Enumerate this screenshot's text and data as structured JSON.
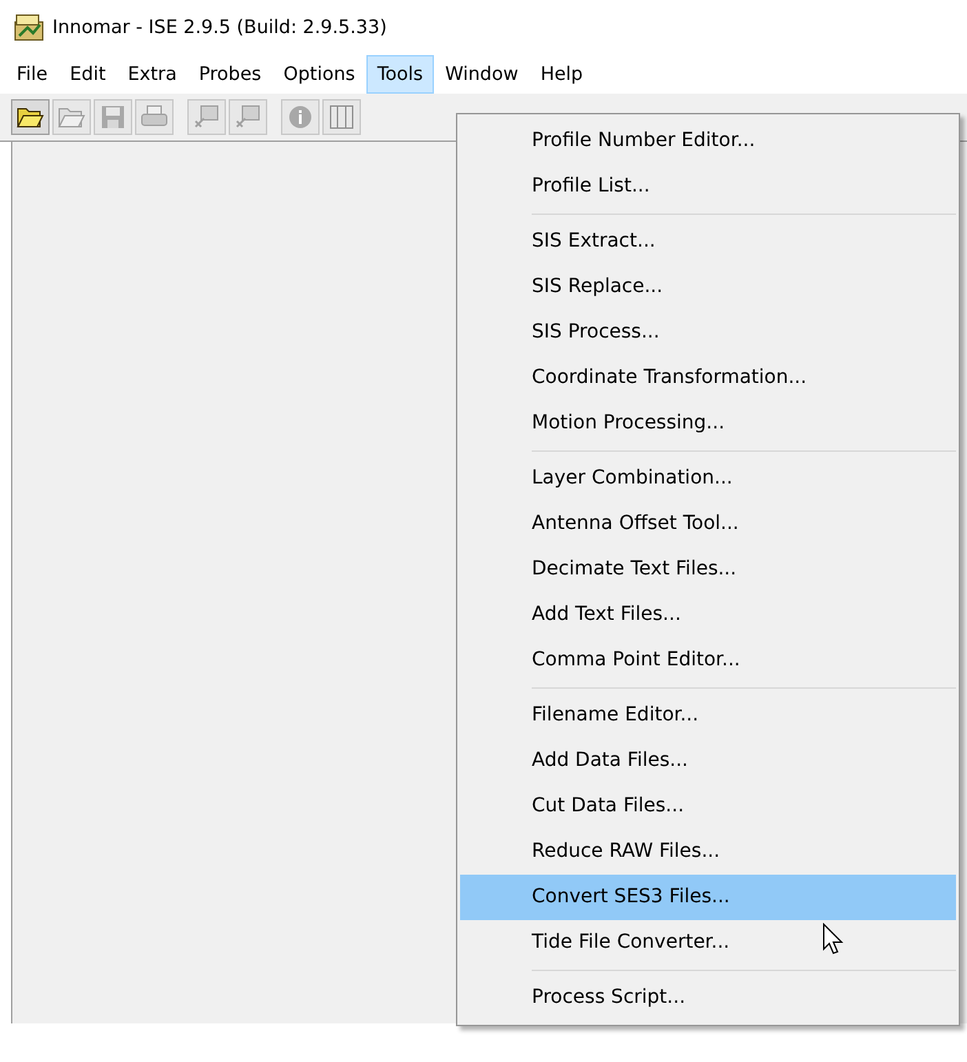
{
  "window": {
    "title": "Innomar - ISE 2.9.5 (Build: 2.9.5.33)"
  },
  "menu_bar": [
    {
      "label": "File",
      "selected": false
    },
    {
      "label": "Edit",
      "selected": false
    },
    {
      "label": "Extra",
      "selected": false
    },
    {
      "label": "Probes",
      "selected": false
    },
    {
      "label": "Options",
      "selected": false
    },
    {
      "label": "Tools",
      "selected": true
    },
    {
      "label": "Window",
      "selected": false
    },
    {
      "label": "Help",
      "selected": false
    }
  ],
  "toolbar": {
    "groups": [
      [
        {
          "disabled": false
        },
        {
          "disabled": true
        },
        {
          "disabled": true
        },
        {
          "disabled": true
        }
      ],
      [
        {
          "disabled": true
        },
        {
          "disabled": true
        }
      ],
      [
        {
          "disabled": true
        },
        {
          "disabled": true
        }
      ]
    ]
  },
  "tools_menu": {
    "groups": [
      [
        {
          "label": "Profile Number Editor...",
          "selected": false
        },
        {
          "label": "Profile List...",
          "selected": false
        }
      ],
      [
        {
          "label": "SIS Extract...",
          "selected": false
        },
        {
          "label": "SIS Replace...",
          "selected": false
        },
        {
          "label": "SIS Process...",
          "selected": false
        },
        {
          "label": "Coordinate Transformation...",
          "selected": false
        },
        {
          "label": "Motion Processing...",
          "selected": false
        }
      ],
      [
        {
          "label": "Layer Combination...",
          "selected": false
        },
        {
          "label": "Antenna Offset Tool...",
          "selected": false
        },
        {
          "label": "Decimate Text Files...",
          "selected": false
        },
        {
          "label": "Add Text Files...",
          "selected": false
        },
        {
          "label": "Comma Point Editor...",
          "selected": false
        }
      ],
      [
        {
          "label": "Filename Editor...",
          "selected": false
        },
        {
          "label": "Add Data Files...",
          "selected": false
        },
        {
          "label": "Cut Data Files...",
          "selected": false
        },
        {
          "label": "Reduce RAW Files...",
          "selected": false
        },
        {
          "label": "Convert SES3 Files...",
          "selected": true
        },
        {
          "label": "Tide File Converter...",
          "selected": false
        }
      ],
      [
        {
          "label": "Process Script...",
          "selected": false
        }
      ]
    ]
  }
}
